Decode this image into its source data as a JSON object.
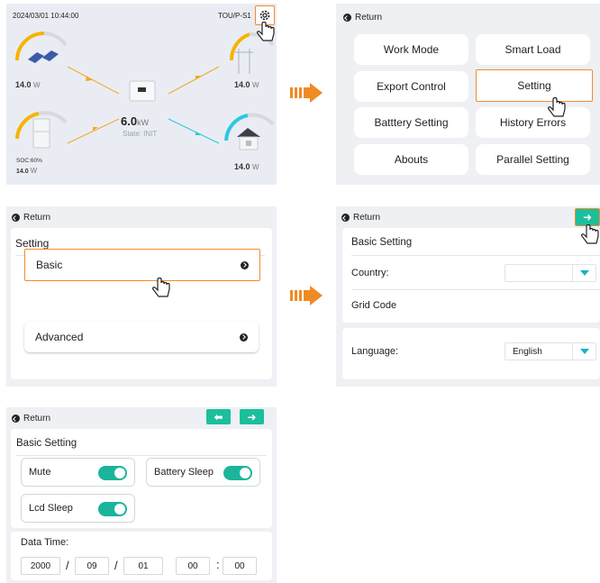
{
  "dashboard": {
    "datetime": "2024/03/01 10:44:00",
    "mode": "TOU/P-S1",
    "pv_value": "14.0",
    "pv_unit": "W",
    "grid_value": "14.0",
    "grid_unit": "W",
    "battery_soc": "SOC:60%",
    "battery_value": "14.0",
    "battery_unit": "W",
    "load_value": "14.0",
    "load_unit": "W",
    "inverter_value": "6.0",
    "inverter_unit": "kW",
    "inverter_state": "State: INIT",
    "settings_icon": "gear-icon"
  },
  "menu": {
    "return_label": "Return",
    "items": [
      "Work Mode",
      "Smart Load",
      "Export Control",
      "Setting",
      "Batttery Setting",
      "History Errors",
      "Abouts",
      "Parallel Setting"
    ],
    "selected": "Setting"
  },
  "setting_page": {
    "return_label": "Return",
    "title": "Setting",
    "items": [
      "Basic",
      "Advanced"
    ],
    "selected": "Basic"
  },
  "basic_page_1": {
    "return_label": "Return",
    "title": "Basic Setting",
    "country_label": "Country:",
    "country_value": "",
    "grid_code_label": "Grid Code",
    "language_label": "Language:",
    "language_value": "English",
    "next_icon": "arrow-right-icon"
  },
  "basic_page_2": {
    "return_label": "Return",
    "title": "Basic Setting",
    "toggles": [
      {
        "label": "Mute",
        "on": true
      },
      {
        "label": "Battery Sleep",
        "on": true
      },
      {
        "label": "Lcd Sleep",
        "on": true
      }
    ],
    "datetime_label": "Data Time:",
    "year": "2000",
    "month": "09",
    "day": "01",
    "hour": "00",
    "minute": "00",
    "date_sep": "/",
    "time_sep": ":",
    "prev_icon": "arrow-left-icon",
    "next_icon": "arrow-right-icon"
  },
  "colors": {
    "highlight": "#f28a2e",
    "accent": "#1bbf9c",
    "flow_orange": "#f5a623",
    "flow_cyan": "#2cc8e0"
  }
}
